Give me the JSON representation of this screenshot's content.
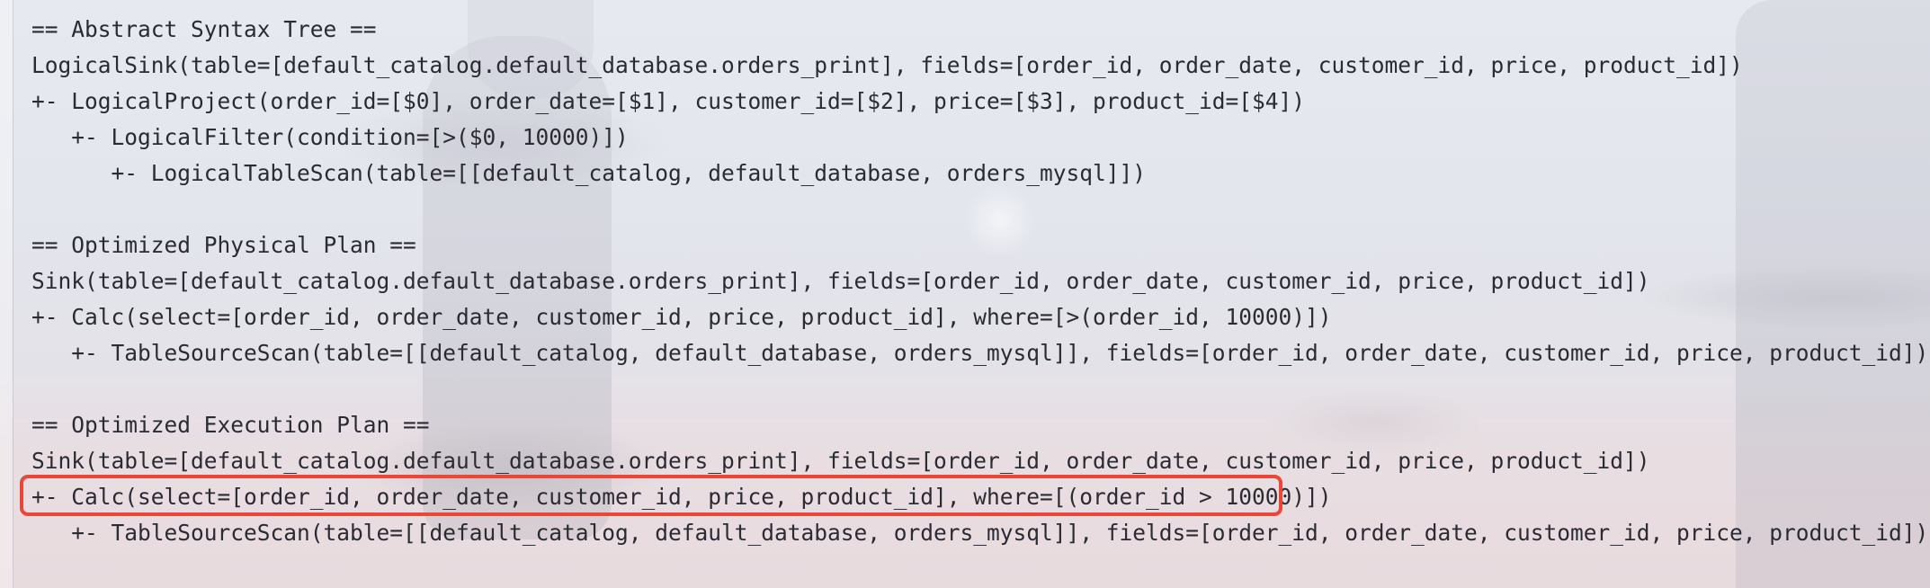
{
  "terminal": {
    "lines": [
      "== Abstract Syntax Tree ==",
      "LogicalSink(table=[default_catalog.default_database.orders_print], fields=[order_id, order_date, customer_id, price, product_id])",
      "+- LogicalProject(order_id=[$0], order_date=[$1], customer_id=[$2], price=[$3], product_id=[$4])",
      "   +- LogicalFilter(condition=[>($0, 10000)])",
      "      +- LogicalTableScan(table=[[default_catalog, default_database, orders_mysql]])",
      "",
      "== Optimized Physical Plan ==",
      "Sink(table=[default_catalog.default_database.orders_print], fields=[order_id, order_date, customer_id, price, product_id])",
      "+- Calc(select=[order_id, order_date, customer_id, price, product_id], where=[>(order_id, 10000)])",
      "   +- TableSourceScan(table=[[default_catalog, default_database, orders_mysql]], fields=[order_id, order_date, customer_id, price, product_id])",
      "",
      "== Optimized Execution Plan ==",
      "Sink(table=[default_catalog.default_database.orders_print], fields=[order_id, order_date, customer_id, price, product_id])",
      "+- Calc(select=[order_id, order_date, customer_id, price, product_id], where=[(order_id > 10000)])",
      "   +- TableSourceScan(table=[[default_catalog, default_database, orders_mysql]], fields=[order_id, order_date, customer_id, price, product_id])"
    ]
  },
  "colors": {
    "text": "#2b2b33",
    "highlight": "#e8473a",
    "link": "#3b6ed6"
  }
}
